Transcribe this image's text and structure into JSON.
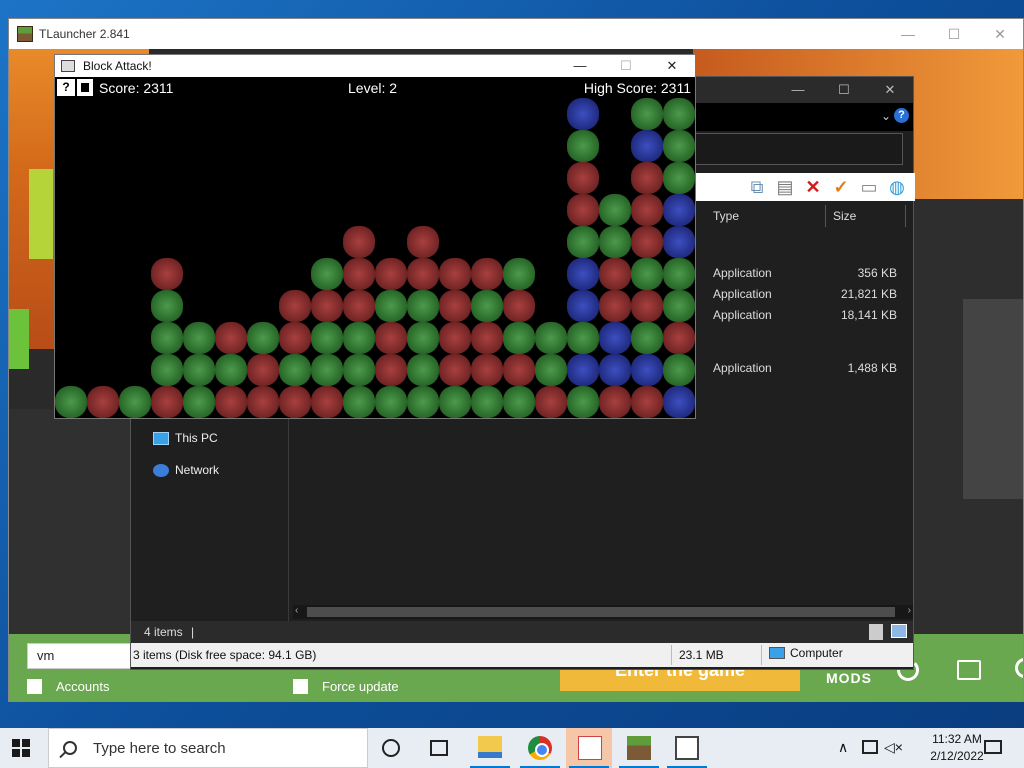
{
  "tlauncher": {
    "title": "TLauncher 2.841",
    "controls": {
      "minimize": "—",
      "maximize": "☐",
      "close": "✕"
    },
    "username": "vm",
    "accounts_label": "Accounts",
    "force_update_label": "Force update",
    "enter_game_label": "Enter the game",
    "mods_label": "MODS"
  },
  "block_attack": {
    "title": "Block Attack!",
    "controls": {
      "minimize": "—",
      "maximize": "☐",
      "close": "✕"
    },
    "help_label": "?",
    "score": "Score: 2311",
    "level": "Level: 2",
    "high_score": "High Score: 2311",
    "colors": {
      "green": "#2d6e2d",
      "red": "#7a2828",
      "blue": "#24308a"
    },
    "board": [
      {
        "c": "b",
        "col": 16,
        "row": 0
      },
      {
        "c": "g",
        "col": 18,
        "row": 0
      },
      {
        "c": "g",
        "col": 19,
        "row": 0
      },
      {
        "c": "g",
        "col": 16,
        "row": 1
      },
      {
        "c": "b",
        "col": 18,
        "row": 1
      },
      {
        "c": "g",
        "col": 19,
        "row": 1
      },
      {
        "c": "r",
        "col": 16,
        "row": 2
      },
      {
        "c": "r",
        "col": 18,
        "row": 2
      },
      {
        "c": "g",
        "col": 19,
        "row": 2
      },
      {
        "c": "r",
        "col": 16,
        "row": 3
      },
      {
        "c": "g",
        "col": 17,
        "row": 3
      },
      {
        "c": "r",
        "col": 18,
        "row": 3
      },
      {
        "c": "b",
        "col": 19,
        "row": 3
      },
      {
        "c": "r",
        "col": 9,
        "row": 4
      },
      {
        "c": "r",
        "col": 11,
        "row": 4
      },
      {
        "c": "g",
        "col": 16,
        "row": 4
      },
      {
        "c": "g",
        "col": 17,
        "row": 4
      },
      {
        "c": "r",
        "col": 18,
        "row": 4
      },
      {
        "c": "b",
        "col": 19,
        "row": 4
      },
      {
        "c": "r",
        "col": 3,
        "row": 5
      },
      {
        "c": "g",
        "col": 8,
        "row": 5
      },
      {
        "c": "r",
        "col": 9,
        "row": 5
      },
      {
        "c": "r",
        "col": 10,
        "row": 5
      },
      {
        "c": "r",
        "col": 11,
        "row": 5
      },
      {
        "c": "r",
        "col": 12,
        "row": 5
      },
      {
        "c": "r",
        "col": 13,
        "row": 5
      },
      {
        "c": "g",
        "col": 14,
        "row": 5
      },
      {
        "c": "b",
        "col": 16,
        "row": 5
      },
      {
        "c": "r",
        "col": 17,
        "row": 5
      },
      {
        "c": "g",
        "col": 18,
        "row": 5
      },
      {
        "c": "g",
        "col": 19,
        "row": 5
      },
      {
        "c": "g",
        "col": 3,
        "row": 6
      },
      {
        "c": "r",
        "col": 7,
        "row": 6
      },
      {
        "c": "r",
        "col": 8,
        "row": 6
      },
      {
        "c": "r",
        "col": 9,
        "row": 6
      },
      {
        "c": "g",
        "col": 10,
        "row": 6
      },
      {
        "c": "g",
        "col": 11,
        "row": 6
      },
      {
        "c": "r",
        "col": 12,
        "row": 6
      },
      {
        "c": "g",
        "col": 13,
        "row": 6
      },
      {
        "c": "r",
        "col": 14,
        "row": 6
      },
      {
        "c": "b",
        "col": 16,
        "row": 6
      },
      {
        "c": "r",
        "col": 17,
        "row": 6
      },
      {
        "c": "r",
        "col": 18,
        "row": 6
      },
      {
        "c": "g",
        "col": 19,
        "row": 6
      },
      {
        "c": "g",
        "col": 3,
        "row": 7
      },
      {
        "c": "g",
        "col": 4,
        "row": 7
      },
      {
        "c": "r",
        "col": 5,
        "row": 7
      },
      {
        "c": "g",
        "col": 6,
        "row": 7
      },
      {
        "c": "r",
        "col": 7,
        "row": 7
      },
      {
        "c": "g",
        "col": 8,
        "row": 7
      },
      {
        "c": "g",
        "col": 9,
        "row": 7
      },
      {
        "c": "r",
        "col": 10,
        "row": 7
      },
      {
        "c": "g",
        "col": 11,
        "row": 7
      },
      {
        "c": "r",
        "col": 12,
        "row": 7
      },
      {
        "c": "r",
        "col": 13,
        "row": 7
      },
      {
        "c": "g",
        "col": 14,
        "row": 7
      },
      {
        "c": "g",
        "col": 15,
        "row": 7
      },
      {
        "c": "g",
        "col": 16,
        "row": 7
      },
      {
        "c": "b",
        "col": 17,
        "row": 7
      },
      {
        "c": "g",
        "col": 18,
        "row": 7
      },
      {
        "c": "r",
        "col": 19,
        "row": 7
      },
      {
        "c": "g",
        "col": 3,
        "row": 8
      },
      {
        "c": "g",
        "col": 4,
        "row": 8
      },
      {
        "c": "g",
        "col": 5,
        "row": 8
      },
      {
        "c": "r",
        "col": 6,
        "row": 8
      },
      {
        "c": "g",
        "col": 7,
        "row": 8
      },
      {
        "c": "g",
        "col": 8,
        "row": 8
      },
      {
        "c": "g",
        "col": 9,
        "row": 8
      },
      {
        "c": "r",
        "col": 10,
        "row": 8
      },
      {
        "c": "g",
        "col": 11,
        "row": 8
      },
      {
        "c": "r",
        "col": 12,
        "row": 8
      },
      {
        "c": "r",
        "col": 13,
        "row": 8
      },
      {
        "c": "r",
        "col": 14,
        "row": 8
      },
      {
        "c": "g",
        "col": 15,
        "row": 8
      },
      {
        "c": "b",
        "col": 16,
        "row": 8
      },
      {
        "c": "b",
        "col": 17,
        "row": 8
      },
      {
        "c": "b",
        "col": 18,
        "row": 8
      },
      {
        "c": "g",
        "col": 19,
        "row": 8
      },
      {
        "c": "g",
        "col": 0,
        "row": 9
      },
      {
        "c": "r",
        "col": 1,
        "row": 9
      },
      {
        "c": "g",
        "col": 2,
        "row": 9
      },
      {
        "c": "r",
        "col": 3,
        "row": 9
      },
      {
        "c": "g",
        "col": 4,
        "row": 9
      },
      {
        "c": "r",
        "col": 5,
        "row": 9
      },
      {
        "c": "r",
        "col": 6,
        "row": 9
      },
      {
        "c": "r",
        "col": 7,
        "row": 9
      },
      {
        "c": "r",
        "col": 8,
        "row": 9
      },
      {
        "c": "g",
        "col": 9,
        "row": 9
      },
      {
        "c": "g",
        "col": 10,
        "row": 9
      },
      {
        "c": "g",
        "col": 11,
        "row": 9
      },
      {
        "c": "g",
        "col": 12,
        "row": 9
      },
      {
        "c": "g",
        "col": 13,
        "row": 9
      },
      {
        "c": "g",
        "col": 14,
        "row": 9
      },
      {
        "c": "r",
        "col": 15,
        "row": 9
      },
      {
        "c": "g",
        "col": 16,
        "row": 9
      },
      {
        "c": "r",
        "col": 17,
        "row": 9
      },
      {
        "c": "r",
        "col": 18,
        "row": 9
      },
      {
        "c": "b",
        "col": 19,
        "row": 9
      }
    ]
  },
  "explorer": {
    "controls": {
      "minimize": "—",
      "maximize": "☐",
      "close": "✕"
    },
    "help_label": "?",
    "columns": {
      "type": "Type",
      "size": "Size"
    },
    "files": [
      {
        "type": "Application",
        "size": "356 KB"
      },
      {
        "type": "Application",
        "size": "21,821 KB"
      },
      {
        "type": "Application",
        "size": "18,141 KB"
      },
      {
        "type": "Application",
        "size": "1,488 KB"
      }
    ],
    "nav": [
      {
        "label": "This PC",
        "icon": "computer-icon"
      },
      {
        "label": "Network",
        "icon": "network-icon"
      }
    ],
    "status_count": "4 items",
    "status_cursor": "|",
    "bottom_free": "3 items (Disk free space: 94.1 GB)",
    "bottom_size": "23.1 MB",
    "bottom_zone": "Computer"
  },
  "taskbar": {
    "search_placeholder": "Type here to search",
    "time": "11:32 AM",
    "date": "2/12/2022"
  }
}
